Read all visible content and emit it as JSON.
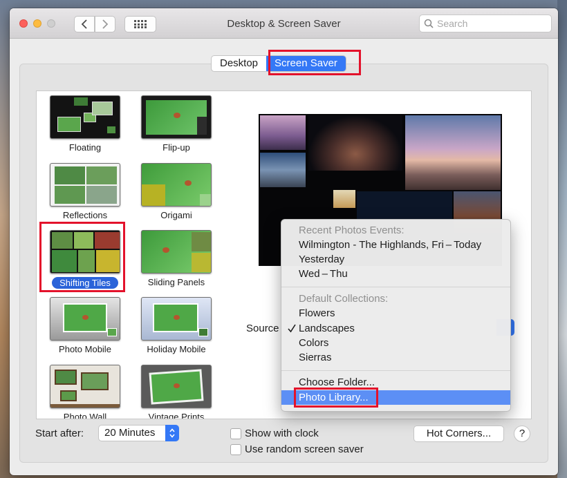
{
  "window": {
    "title": "Desktop & Screen Saver"
  },
  "search": {
    "placeholder": "Search"
  },
  "tabs": [
    {
      "label": "Desktop",
      "active": false
    },
    {
      "label": "Screen Saver",
      "active": true
    }
  ],
  "screen_savers": [
    {
      "label": "Floating"
    },
    {
      "label": "Flip-up"
    },
    {
      "label": "Reflections"
    },
    {
      "label": "Origami"
    },
    {
      "label": "Shifting Tiles",
      "selected": true
    },
    {
      "label": "Sliding Panels"
    },
    {
      "label": "Photo Mobile"
    },
    {
      "label": "Holiday Mobile"
    },
    {
      "label": "Photo Wall"
    },
    {
      "label": "Vintage Prints"
    }
  ],
  "source": {
    "label": "Source"
  },
  "source_menu": {
    "recent_header": "Recent Photos Events:",
    "recent_items": [
      "Wilmington - The Highlands, Fri – Today",
      "Yesterday",
      "Wed – Thu"
    ],
    "collections_header": "Default Collections:",
    "collections": [
      {
        "label": "Flowers",
        "checked": false
      },
      {
        "label": "Landscapes",
        "checked": true
      },
      {
        "label": "Colors",
        "checked": false
      },
      {
        "label": "Sierras",
        "checked": false
      }
    ],
    "choose_folder": "Choose Folder...",
    "photo_library": "Photo Library..."
  },
  "start_after": {
    "label": "Start after:",
    "value": "20 Minutes"
  },
  "options": {
    "show_clock": {
      "label": "Show with clock",
      "checked": false
    },
    "random_saver": {
      "label": "Use random screen saver",
      "checked": false
    }
  },
  "hot_corners": {
    "label": "Hot Corners..."
  },
  "help": {
    "label": "?"
  },
  "colors": {
    "accent": "#3478f6",
    "highlight_box": "#e3122b",
    "menu_highlight": "#5c8ff5"
  }
}
